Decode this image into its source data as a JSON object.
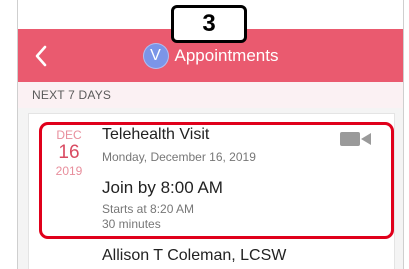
{
  "header": {
    "avatar_letter": "V",
    "title": "Appointments",
    "step_number": "3"
  },
  "section": {
    "label": "NEXT 7 DAYS"
  },
  "appointment": {
    "date": {
      "month": "DEC",
      "day": "16",
      "year": "2019"
    },
    "title": "Telehealth Visit",
    "full_date": "Monday, December 16, 2019",
    "join_text": "Join by 8:00 AM",
    "starts_at": "Starts at 8:20 AM",
    "duration": "30 minutes",
    "provider": "Allison T Coleman, LCSW",
    "icon": "video-camera-icon"
  },
  "colors": {
    "header_bg": "#ea5a6f",
    "highlight": "#e0001b",
    "date_accent": "#d94b62",
    "avatar_bg": "#7b95e8"
  }
}
